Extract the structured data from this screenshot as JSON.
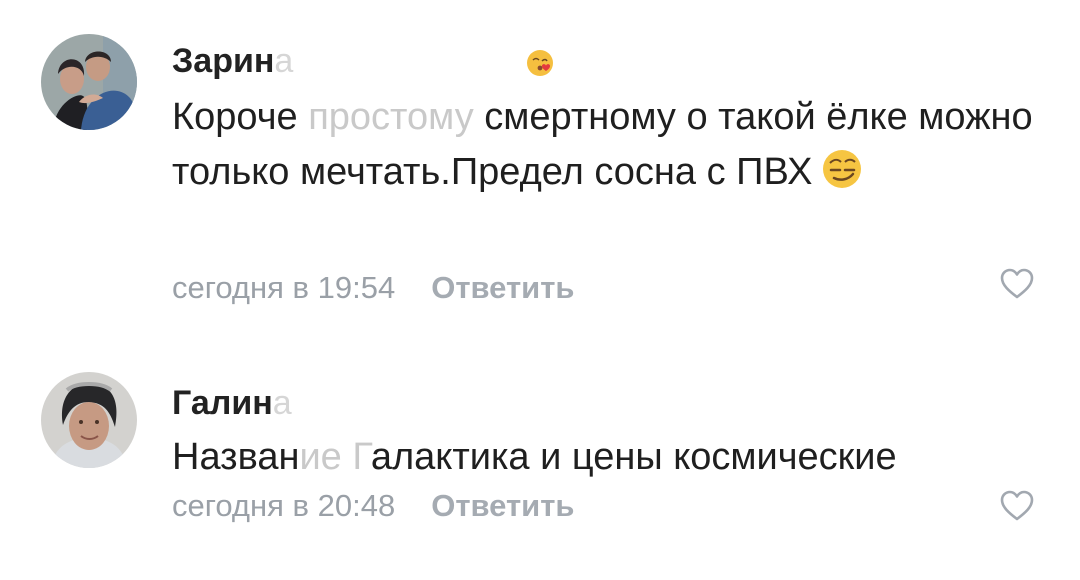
{
  "comments": [
    {
      "author": {
        "visible": "Зарин",
        "faded": "а"
      },
      "text": {
        "start": "Короче ",
        "faded": "простому",
        "end": " смертному о такой ёлке можно только мечтать.Предел сосна с ПВХ"
      },
      "time": "сегодня в 19:54",
      "reply_label": "Ответить",
      "name_emoji": "kissing-heart-emoji",
      "inline_emoji": "smirk-emoji"
    },
    {
      "author": {
        "visible": "Галин",
        "faded": "а"
      },
      "text": {
        "start": "Назван",
        "faded": "ие Г",
        "end": "алактика и цены космические"
      },
      "time": "сегодня в 20:48",
      "reply_label": "Ответить"
    }
  ],
  "colors": {
    "text": "#1f1f1f",
    "meta": "#9aa0a7",
    "faded": "#c9c9c9",
    "background": "#ffffff"
  },
  "icons": {
    "like": "heart-outline-icon"
  }
}
